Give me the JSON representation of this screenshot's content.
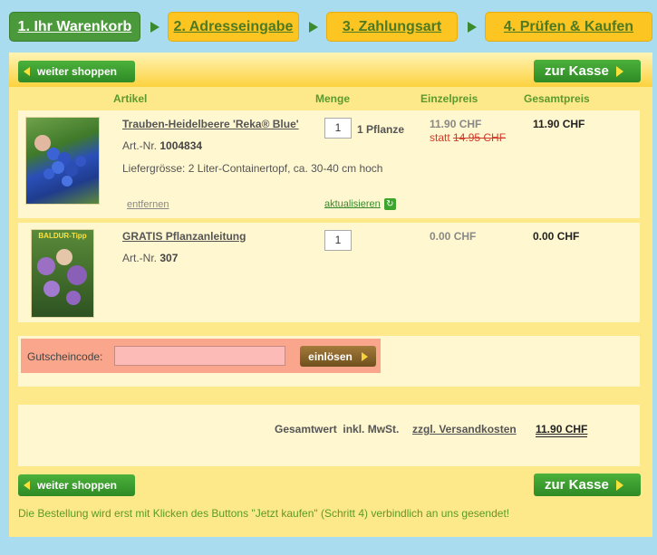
{
  "steps": [
    {
      "label": "1. Ihr Warenkorb"
    },
    {
      "label": "2. Adresseingabe"
    },
    {
      "label": "3. Zahlungsart"
    },
    {
      "label": "4. Prüfen & Kaufen"
    }
  ],
  "nav": {
    "continue_label": "weiter shoppen",
    "checkout_label": "zur Kasse"
  },
  "columns": {
    "article": "Artikel",
    "quantity": "Menge",
    "unit_price": "Einzelpreis",
    "total_price": "Gesamtpreis"
  },
  "items": [
    {
      "title": "Trauben-Heidelbeere 'Reka® Blue'",
      "art_label": "Art.-Nr.",
      "art_nr": "1004834",
      "delivery": "Liefergrösse: 2 Liter-Containertopf, ca. 30-40 cm hoch",
      "qty": "1",
      "unit": "1 Pflanze",
      "unit_price": "11.90 CHF",
      "old_price_prefix": "statt",
      "old_price": "14.95 CHF",
      "total": "11.90 CHF",
      "remove_label": "entfernen",
      "update_label": "aktualisieren"
    },
    {
      "title": "GRATIS Pflanzanleitung",
      "art_label": "Art.-Nr.",
      "art_nr": "307",
      "qty": "1",
      "unit_price": "0.00 CHF",
      "total": "0.00 CHF",
      "thumb_label": "BALDUR-Tipp"
    }
  ],
  "coupon": {
    "label": "Gutscheincode:",
    "value": "",
    "button": "einlösen"
  },
  "totals": {
    "label": "Gesamtwert  inkl. MwSt.",
    "shipping_link": "zzgl. Versandkosten",
    "amount": "11.90 CHF"
  },
  "footer_note": "Die Bestellung wird erst mit Klicken des Buttons \"Jetzt kaufen\" (Schritt 4) verbindlich an uns gesendet!",
  "colors": {
    "accent_green": "#4a9a3c",
    "step_yellow": "#fcc521",
    "coupon_bg": "#f9a68d",
    "strike_red": "#d23b2a"
  }
}
